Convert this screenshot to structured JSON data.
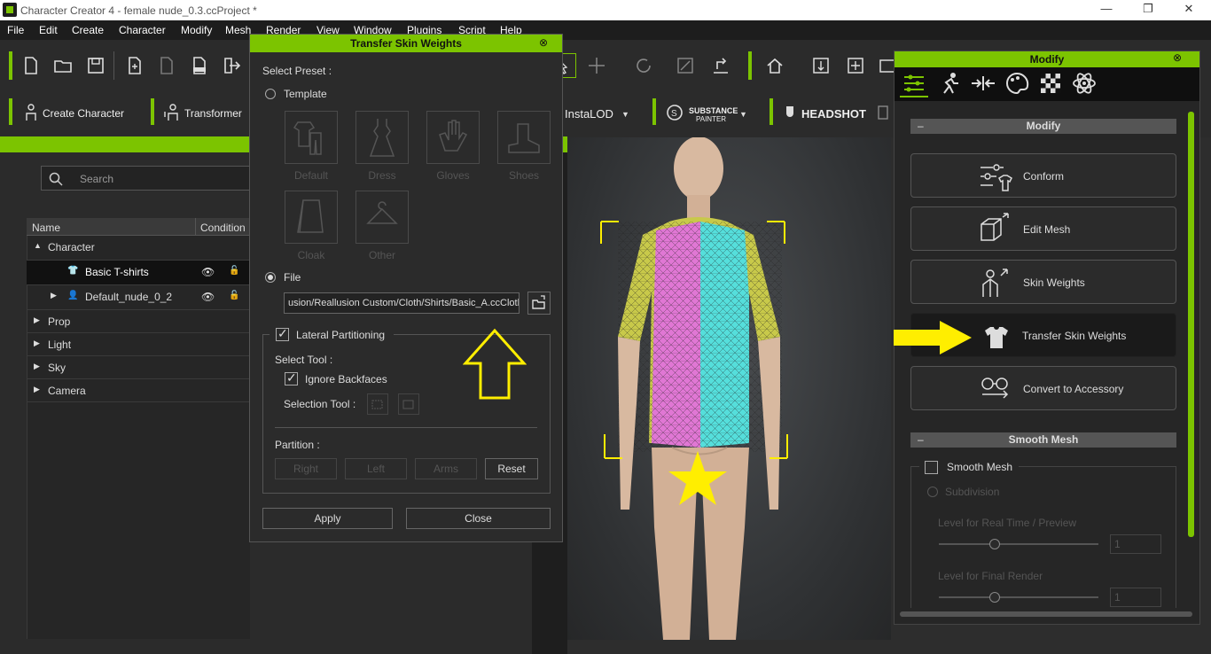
{
  "window": {
    "title": "Character Creator 4 - female nude_0.3.ccProject *",
    "minimize": "—",
    "restore": "❐",
    "close": "✕"
  },
  "menu": [
    "File",
    "Edit",
    "Create",
    "Character",
    "Modify",
    "Mesh",
    "Render",
    "View",
    "Window",
    "Plugins",
    "Script",
    "Help"
  ],
  "toolbar2": {
    "create_character": "Create Character",
    "transformer": "Transformer",
    "instalod": "InstaLOD",
    "substance_top": "SUBSTANCE",
    "substance_bottom": "PAINTER",
    "headshot": "HEADSHOT"
  },
  "scene": {
    "search_placeholder": "Search",
    "columns": [
      "Name",
      "Condition"
    ],
    "rows": [
      {
        "label": "Character"
      },
      {
        "label": "Basic T-shirts"
      },
      {
        "label": "Default_nude_0_2"
      },
      {
        "label": "Prop"
      },
      {
        "label": "Light"
      },
      {
        "label": "Sky"
      },
      {
        "label": "Camera"
      }
    ]
  },
  "dialog": {
    "title": "Transfer Skin Weights",
    "select_preset": "Select Preset :",
    "template": "Template",
    "tiles": [
      "Default",
      "Dress",
      "Gloves",
      "Shoes",
      "Cloak",
      "Other"
    ],
    "file": "File",
    "file_path": "usion/Reallusion Custom/Cloth/Shirts/Basic_A.ccCloth",
    "lateral_partitioning": "Lateral Partitioning",
    "select_tool": "Select Tool :",
    "ignore_backfaces": "Ignore Backfaces",
    "selection_tool": "Selection Tool :",
    "partition": "Partition :",
    "right": "Right",
    "left": "Left",
    "arms": "Arms",
    "reset": "Reset",
    "apply": "Apply",
    "close": "Close"
  },
  "modify": {
    "title": "Modify",
    "section_modify": "Modify",
    "buttons": [
      "Conform",
      "Edit Mesh",
      "Skin Weights",
      "Transfer Skin Weights",
      "Convert to Accessory"
    ],
    "section_smooth": "Smooth Mesh",
    "smooth_mesh": "Smooth Mesh",
    "subdivision": "Subdivision",
    "level_realtime": "Level for Real Time / Preview",
    "level_final": "Level for Final Render",
    "level_value1": "1",
    "level_value2": "1"
  },
  "colors": {
    "accent": "#7cc400",
    "annotation": "#ffee00",
    "shirt_left": "#e77ad8",
    "shirt_right": "#5ae0e0",
    "sleeve": "#e8ea5a"
  }
}
